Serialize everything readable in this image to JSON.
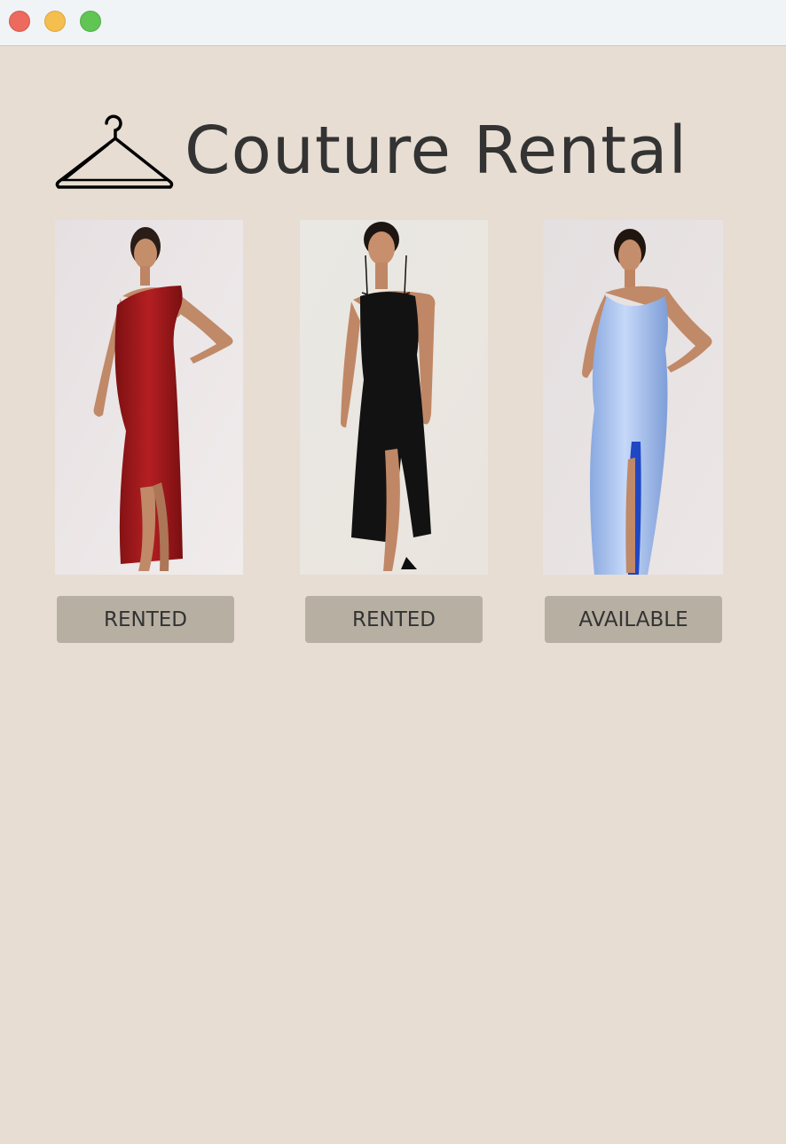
{
  "window": {
    "controls": [
      "close",
      "minimize",
      "zoom"
    ]
  },
  "header": {
    "title": "Couture Rental",
    "icon": "hanger-icon"
  },
  "dresses": [
    {
      "photo": "model in red one-shoulder satin maxi dress",
      "dress_color": "#a31a1c",
      "status": "RENTED"
    },
    {
      "photo": "model in black halter maxi dress",
      "dress_color": "#141414",
      "status": "RENTED"
    },
    {
      "photo": "model in light blue satin cowl-neck maxi dress",
      "dress_color": "#a9c4ef",
      "status": "AVAILABLE"
    }
  ],
  "colors": {
    "background": "#e7ddd2",
    "button": "#b7afa2",
    "text": "#333333",
    "titlebar": "#f1f4f6"
  }
}
